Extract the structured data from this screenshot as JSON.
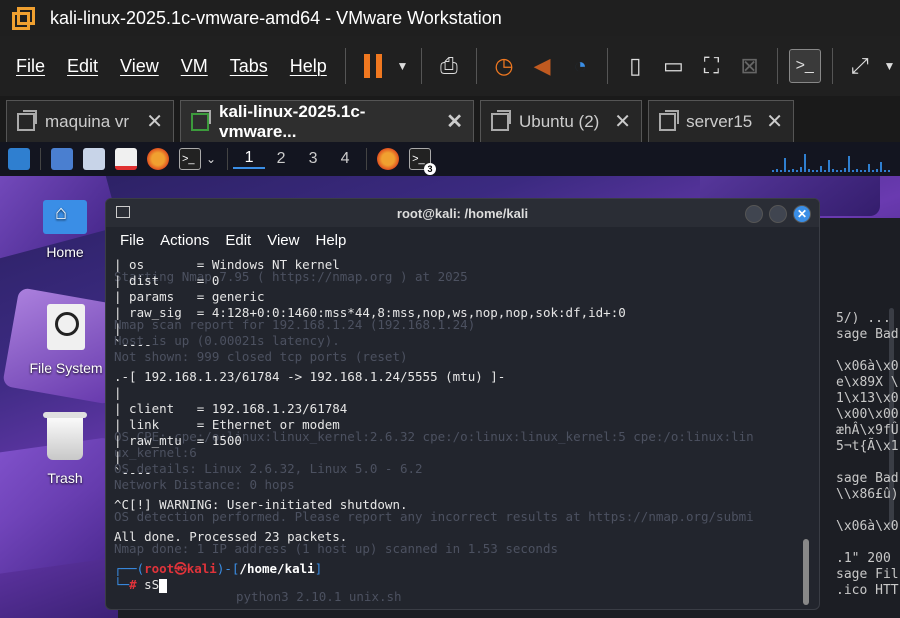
{
  "window": {
    "title": "kali-linux-2025.1c-vmware-amd64 - VMware Workstation"
  },
  "menu": [
    "File",
    "Edit",
    "View",
    "VM",
    "Tabs",
    "Help"
  ],
  "tabs": [
    {
      "label": "maquina vr"
    },
    {
      "label": "kali-linux-2025.1c-vmware..."
    },
    {
      "label": "Ubuntu (2)"
    },
    {
      "label": "server15"
    }
  ],
  "kali_panel": {
    "workspaces": [
      "1",
      "2",
      "3",
      "4"
    ],
    "terminal_badge": "3"
  },
  "desktop_icons": [
    {
      "label": "Home"
    },
    {
      "label": "File System"
    },
    {
      "label": "Trash"
    }
  ],
  "terminal": {
    "title": "root@kali: /home/kali",
    "menu": [
      "File",
      "Actions",
      "Edit",
      "View",
      "Help"
    ],
    "lines": [
      "| os       = Windows NT kernel",
      "| dist     = 0",
      "| params   = generic",
      "| raw_sig  = 4:128+0:0:1460:mss*44,8:mss,nop,ws,nop,nop,sok:df,id+:0",
      "|",
      "`----",
      "",
      ".-[ 192.168.1.23/61784 -> 192.168.1.24/5555 (mtu) ]-",
      "|",
      "| client   = 192.168.1.23/61784",
      "| link     = Ethernet or modem",
      "| raw_mtu  = 1500",
      "|",
      "`----",
      "",
      "^C[!] WARNING: User-initiated shutdown.",
      "",
      "All done. Processed 23 packets."
    ],
    "prompt_user": "root",
    "prompt_host": "kali",
    "prompt_path": "/home/kali",
    "command": "sS"
  },
  "ghost_lines": [
    "Starting Nmap 7.95 ( https://nmap.org ) at 2025",
    "Host is up (0.00021s latency).",
    "Nmap scan report for 192.168.1.24 (192.168.1.24)",
    "Not shown: 999 closed tcp ports (reset)",
    "OS CPE: cpe:/o:linux:linux_kernel:2.6.32 cpe:/o:linux:linux_kernel:5 cpe:/o:linux:lin",
    "ux_kernel:6",
    "OS details: Linux 2.6.32, Linux 5.0 - 6.2",
    "Network Distance: 0 hops",
    "OS detection performed. Please report any incorrect results at https://nmap.org/submi",
    "Nmap done: 1 IP address (1 host up) scanned in 1.53 seconds",
    "python3 2.10.1 unix.sh"
  ],
  "bg_right_lines": [
    "5/) ...",
    "sage Bad",
    "",
    "\\x06à\\x0",
    "e\\x89X \\",
    "1\\x13\\x0",
    "\\x00\\x00",
    "æhÂ\\x9fÛ",
    "5¬t{Ã\\x1",
    "",
    "sage Bad",
    "\\\\x86£û)",
    "",
    "\\x06à\\x0",
    "",
    ".1\" 200",
    "sage Fil",
    ".ico HTT"
  ]
}
